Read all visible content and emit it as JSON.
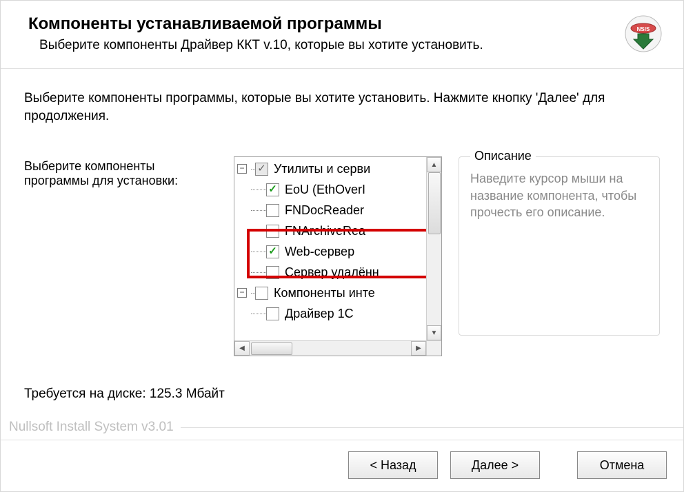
{
  "header": {
    "title": "Компоненты устанавливаемой программы",
    "subtitle": "Выберите компоненты Драйвер ККТ v.10, которые вы хотите установить."
  },
  "body": {
    "instructions": "Выберите компоненты программы, которые вы хотите установить. Нажмите кнопку 'Далее' для продолжения.",
    "select_label": "Выберите компоненты программы для установки:",
    "disk_label": "Требуется на диске: 125.3 Мбайт"
  },
  "tree": {
    "group1_label": "Утилиты и серви",
    "items1": {
      "eou": "EoU (EthOverI",
      "fndoc": "FNDocReader",
      "fnarchive": "FNArchiveRea",
      "web": "Web-сервер",
      "remote": "Сервер удалённ"
    },
    "group2_label": "Компоненты инте",
    "items2": {
      "driver1c": "Драйвер 1С"
    },
    "checked": {
      "group1": "mixed",
      "eou": true,
      "fndoc": false,
      "fnarchive": false,
      "web": true,
      "remote": false,
      "group2": false,
      "driver1c": false
    }
  },
  "description": {
    "legend": "Описание",
    "body": "Наведите курсор мыши на название компонента, чтобы прочесть его описание."
  },
  "footer": {
    "brand": "Nullsoft Install System v3.01",
    "back": "< Назад",
    "next": "Далее >",
    "cancel": "Отмена"
  }
}
